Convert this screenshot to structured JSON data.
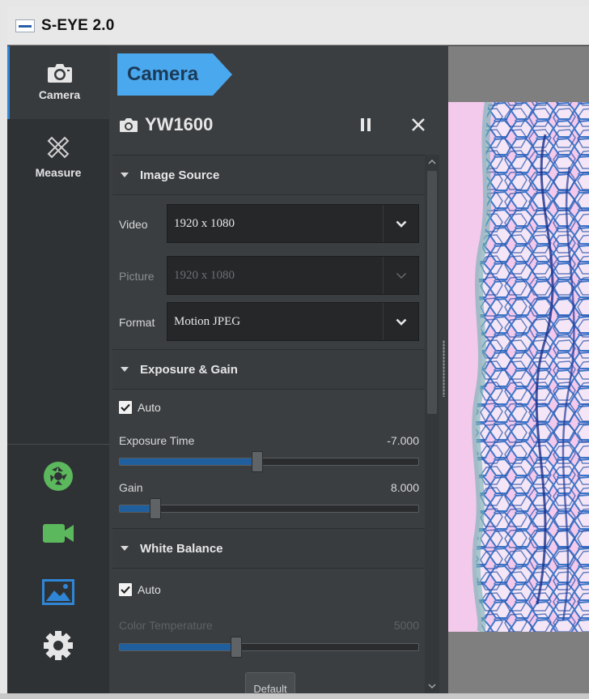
{
  "app": {
    "title": "S-EYE 2.0"
  },
  "sidebar": {
    "tabs": [
      {
        "label": "Camera",
        "icon": "camera-icon",
        "active": true
      },
      {
        "label": "Measure",
        "icon": "measure-icon",
        "active": false
      }
    ],
    "tools": [
      {
        "icon": "aperture-capture-icon",
        "color": "#5cb85c"
      },
      {
        "icon": "video-record-icon",
        "color": "#5cb85c"
      },
      {
        "icon": "image-gallery-icon",
        "color": "#2f86d6"
      },
      {
        "icon": "settings-gear-icon",
        "color": "#e6e6e6"
      }
    ]
  },
  "panel": {
    "breadcrumb": "Camera",
    "device_name": "YW1600",
    "sections": {
      "image_source": {
        "title": "Image Source",
        "video_label": "Video",
        "video_value": "1920 x 1080",
        "picture_label": "Picture",
        "picture_value": "1920 x 1080",
        "format_label": "Format",
        "format_value": "Motion JPEG"
      },
      "exposure": {
        "title": "Exposure & Gain",
        "auto_label": "Auto",
        "auto_checked": true,
        "exposure_label": "Exposure Time",
        "exposure_value": "-7.000",
        "exposure_level": 0.46,
        "gain_label": "Gain",
        "gain_value": "8.000",
        "gain_level": 0.12
      },
      "white_balance": {
        "title": "White Balance",
        "auto_label": "Auto",
        "auto_checked": true,
        "temp_label": "Color Temperature",
        "temp_value": "5000",
        "temp_level": 0.39,
        "default_button": "Default"
      }
    }
  },
  "colors": {
    "accent": "#2f86d6",
    "breadcrumb_bg": "#4aa8ee",
    "slider_fill": "#1f5f9e",
    "tool_green": "#5cb85c"
  }
}
